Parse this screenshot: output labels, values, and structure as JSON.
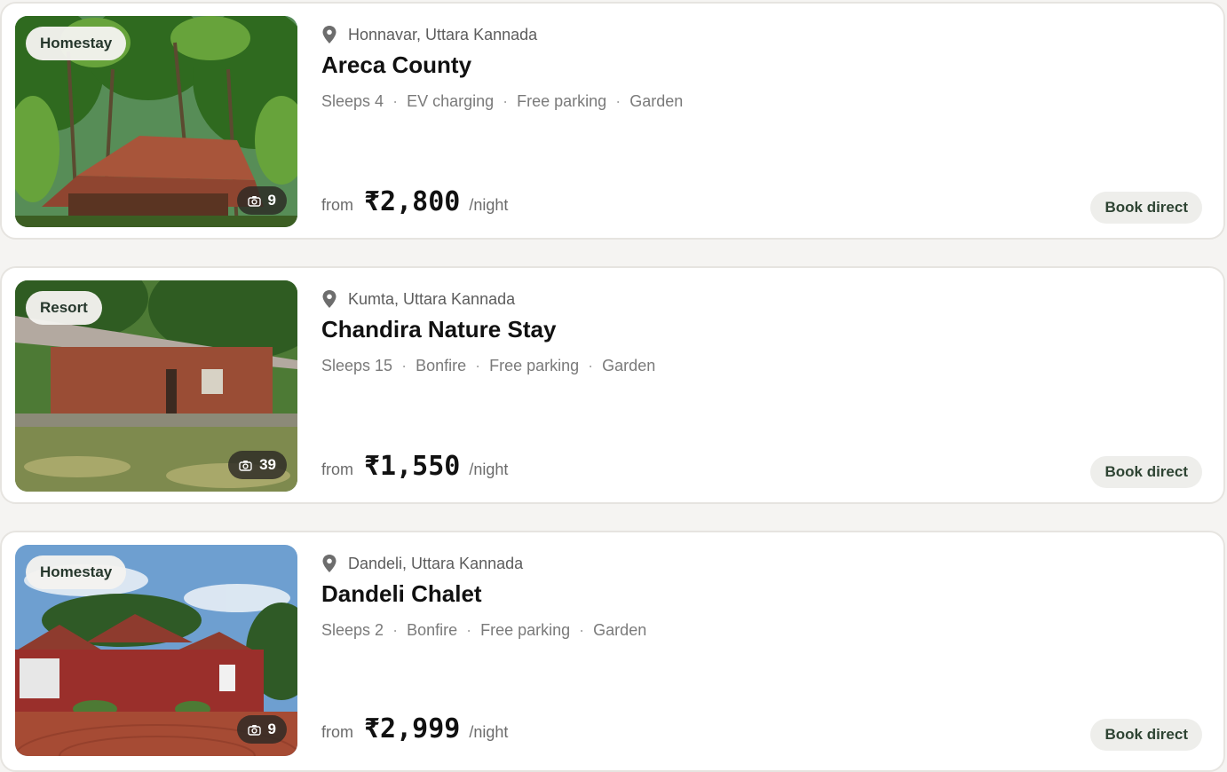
{
  "listings": [
    {
      "type": "Homestay",
      "photo_count": "9",
      "location": "Honnavar, Uttara Kannada",
      "name": "Areca County",
      "features": [
        "Sleeps 4",
        "EV charging",
        "Free parking",
        "Garden"
      ],
      "price_prefix": "from",
      "price": "₹2,800",
      "price_suffix": "/night",
      "cta": "Book direct"
    },
    {
      "type": "Resort",
      "photo_count": "39",
      "location": "Kumta, Uttara Kannada",
      "name": "Chandira Nature Stay",
      "features": [
        "Sleeps 15",
        "Bonfire",
        "Free parking",
        "Garden"
      ],
      "price_prefix": "from",
      "price": "₹1,550",
      "price_suffix": "/night",
      "cta": "Book direct"
    },
    {
      "type": "Homestay",
      "photo_count": "9",
      "location": "Dandeli, Uttara Kannada",
      "name": "Dandeli Chalet",
      "features": [
        "Sleeps 2",
        "Bonfire",
        "Free parking",
        "Garden"
      ],
      "price_prefix": "from",
      "price": "₹2,999",
      "price_suffix": "/night",
      "cta": "Book direct"
    }
  ],
  "icons": {
    "location": "map-pin-icon",
    "photos": "camera-icon"
  },
  "colors": {
    "badge_text": "#26372c",
    "cta_background": "#eeeeeb",
    "cta_text": "#2e4433"
  }
}
